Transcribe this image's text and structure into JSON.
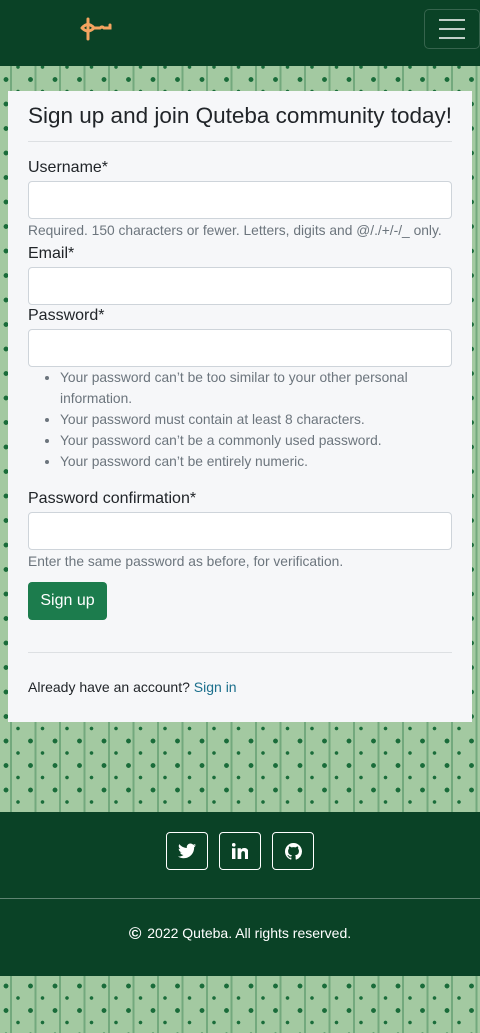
{
  "header": {
    "logo": "quteba-logo",
    "menu_toggle": "hamburger-icon",
    "brand_color": "#f4a460"
  },
  "form": {
    "title": "Sign up and join Quteba community today!",
    "username_label": "Username*",
    "username_value": "",
    "username_help": "Required. 150 characters or fewer. Letters, digits and @/./+/-/_ only.",
    "email_label": "Email*",
    "email_value": "",
    "password_label": "Password*",
    "password_value": "",
    "password_rules": [
      "Your password can’t be too similar to your other personal information.",
      "Your password must contain at least 8 characters.",
      "Your password can’t be a commonly used password.",
      "Your password can’t be entirely numeric."
    ],
    "password2_label": "Password confirmation*",
    "password2_value": "",
    "password2_help": "Enter the same password as before, for verification.",
    "submit_label": "Sign up",
    "signin_prompt": "Already have an account?",
    "signin_link": "Sign in",
    "accent_color": "#1c7c4d"
  },
  "footer": {
    "social": [
      "twitter-icon",
      "linkedin-icon",
      "github-icon"
    ],
    "copyright": "2022 Quteba. All rights reserved.",
    "background": "#0a4226"
  }
}
